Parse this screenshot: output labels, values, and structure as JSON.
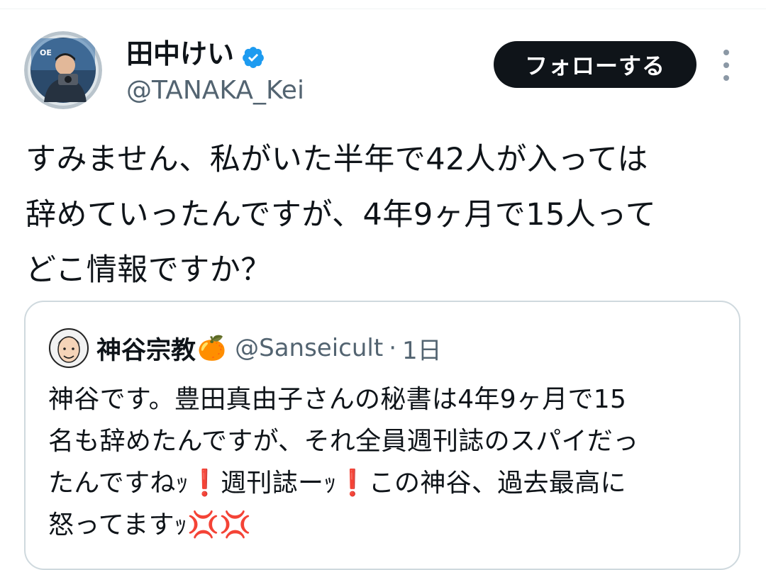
{
  "author": {
    "display_name": "田中けい",
    "handle": "@TANAKA_Kei",
    "verified_icon": "verified-badge-icon",
    "avatar_icon": "user-avatar"
  },
  "follow_button": {
    "label": "フォローする"
  },
  "more_icon": "more-options-icon",
  "tweet": {
    "lines": [
      "すみません、私がいた半年で42人が入っては",
      "辞めていったんですが、4年9ヶ月で15人って",
      "どこ情報ですか？"
    ]
  },
  "quote": {
    "avatar_icon": "quoted-user-avatar",
    "display_name": "神谷宗教",
    "name_emoji": "🍊",
    "handle": "@Sanseicult",
    "separator": "·",
    "time": "1日",
    "lines": [
      "神谷です。豊田真由子さんの秘書は4年9ヶ月で15",
      "名も辞めたんですが、それ全員週刊誌のスパイだっ",
      "たんですねｯ❗週刊誌ーｯ❗この神谷、過去最高に",
      "怒ってますｯ💢💢"
    ]
  },
  "colors": {
    "text": "#0f1419",
    "secondary": "#536471",
    "verified": "#1d9bf0",
    "button_bg": "#0f1419",
    "border": "#cfd9de"
  }
}
